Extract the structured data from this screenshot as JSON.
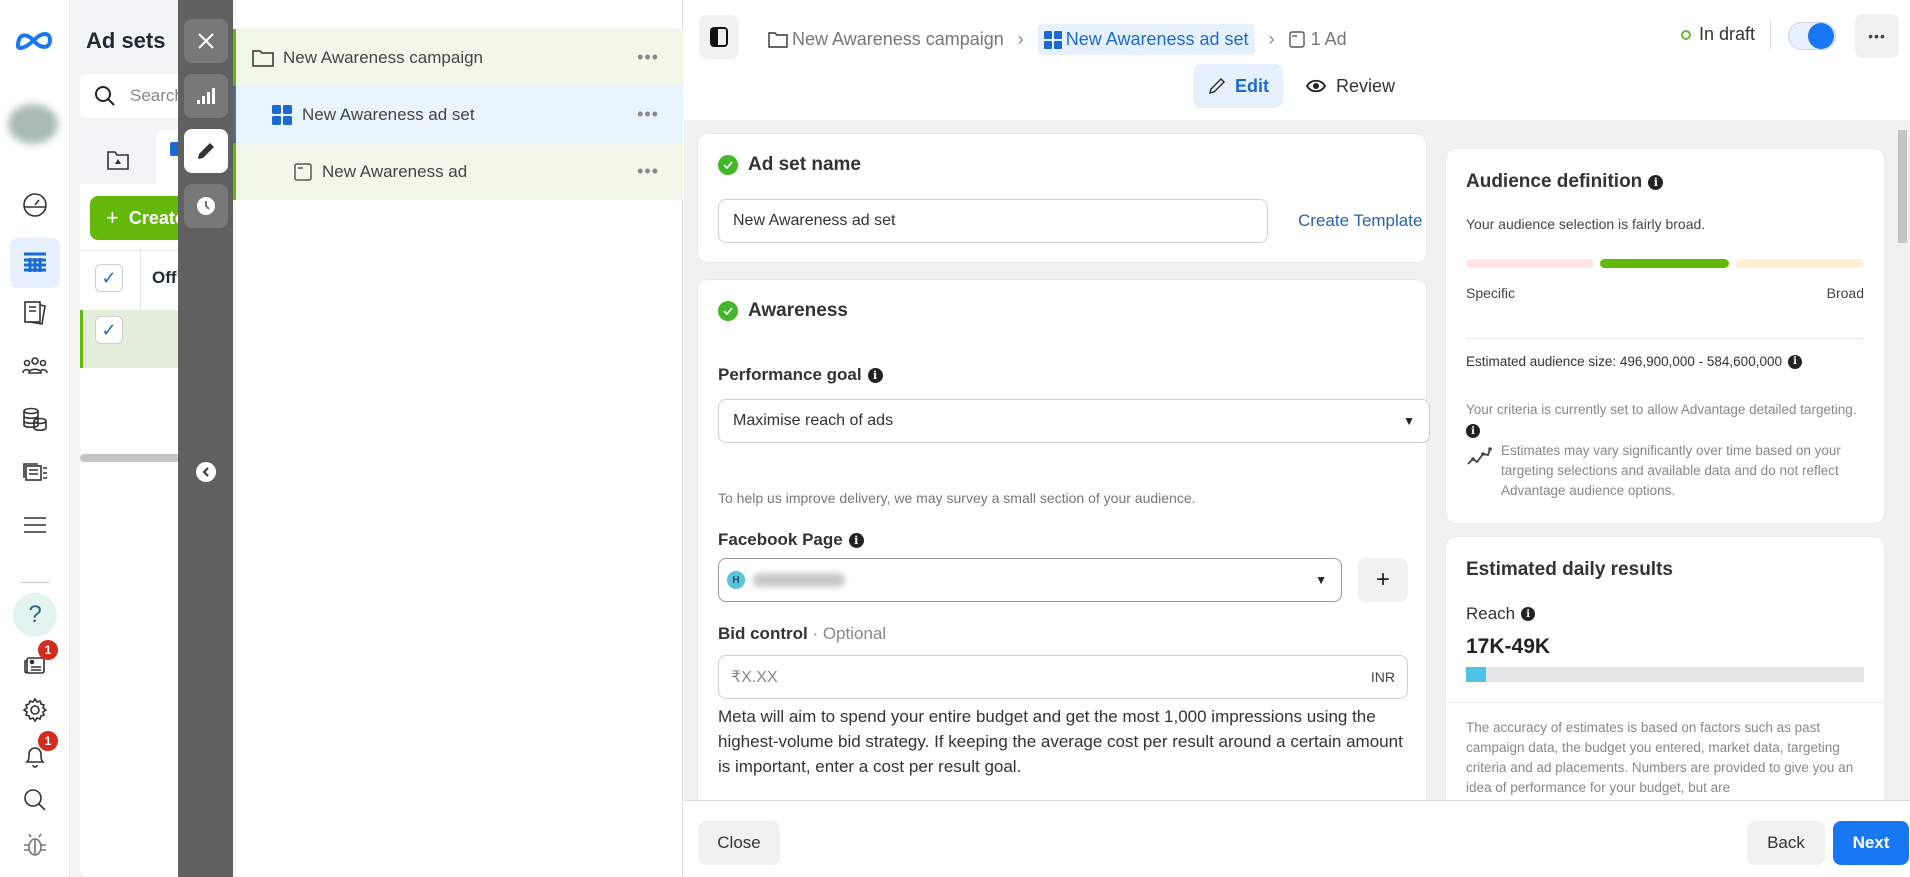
{
  "rail": {
    "logo": "meta-logo",
    "items": [
      {
        "name": "dashboard",
        "icon": "gauge-icon"
      },
      {
        "name": "campaigns-table",
        "icon": "table-icon",
        "active": true
      },
      {
        "name": "pages",
        "icon": "documents-icon"
      },
      {
        "name": "audiences",
        "icon": "people-icon"
      },
      {
        "name": "billing",
        "icon": "coins-icon"
      },
      {
        "name": "creative-hub",
        "icon": "media-icon"
      },
      {
        "name": "all-tools",
        "icon": "menu-icon"
      }
    ],
    "bottom": [
      {
        "name": "help",
        "icon": "question-icon"
      },
      {
        "name": "news",
        "icon": "newspaper-icon",
        "badge": "1"
      },
      {
        "name": "settings",
        "icon": "gear-icon"
      },
      {
        "name": "notifications",
        "icon": "bell-icon",
        "badge": "1"
      },
      {
        "name": "search",
        "icon": "search-icon"
      },
      {
        "name": "report-bug",
        "icon": "bug-icon"
      }
    ]
  },
  "adsets_panel": {
    "title": "Ad sets",
    "search_placeholder": "Search",
    "create_label": "Create",
    "column_header": "Off"
  },
  "tree": {
    "items": [
      {
        "label": "New Awareness campaign",
        "type": "campaign"
      },
      {
        "label": "New Awareness ad set",
        "type": "adset",
        "selected": true
      },
      {
        "label": "New Awareness ad",
        "type": "ad"
      }
    ]
  },
  "header": {
    "breadcrumb": [
      {
        "label": "New Awareness campaign"
      },
      {
        "label": "New Awareness ad set",
        "active": true
      },
      {
        "label": "1 Ad"
      }
    ],
    "status": "In draft",
    "toggle_on": true,
    "tabs": [
      {
        "label": "Edit",
        "active": true
      },
      {
        "label": "Review"
      }
    ]
  },
  "adset_name": {
    "title": "Ad set name",
    "value": "New Awareness ad set",
    "create_template": "Create Template"
  },
  "awareness": {
    "title": "Awareness",
    "performance_goal_label": "Performance goal",
    "performance_goal_value": "Maximise reach of ads",
    "survey_note": "To help us improve delivery, we may survey a small section of your audience.",
    "facebook_page_label": "Facebook Page",
    "facebook_page_initial": "H",
    "bid_control_label": "Bid control",
    "bid_control_optional": "· Optional",
    "bid_placeholder": "₹X.XX",
    "bid_currency": "INR",
    "bid_description": "Meta will aim to spend your entire budget and get the most 1,000 impressions using the highest-volume bid strategy. If keeping the average cost per result around a certain amount is important, enter a cost per result goal."
  },
  "audience": {
    "title": "Audience definition",
    "summary": "Your audience selection is fairly broad.",
    "gauge_position": "middle",
    "specific_label": "Specific",
    "broad_label": "Broad",
    "estimated_size": "Estimated audience size: 496,900,000 - 584,600,000",
    "criteria_note": "Your criteria is currently set to allow Advantage detailed targeting.",
    "estimates_note": "Estimates may vary significantly over time based on your targeting selections and available data and do not reflect Advantage audience options."
  },
  "daily_results": {
    "title": "Estimated daily results",
    "reach_label": "Reach",
    "reach_value": "17K-49K",
    "reach_bar_fraction": 0.05,
    "accuracy_note": "The accuracy of estimates is based on factors such as past campaign data, the budget you entered, market data, targeting criteria and ad placements. Numbers are provided to give you an idea of performance for your budget, but are"
  },
  "footer": {
    "close": "Close",
    "back": "Back",
    "next": "Next"
  },
  "colors": {
    "accent_blue": "#1877f2",
    "green": "#42b72a",
    "create_green": "#63b90b"
  }
}
